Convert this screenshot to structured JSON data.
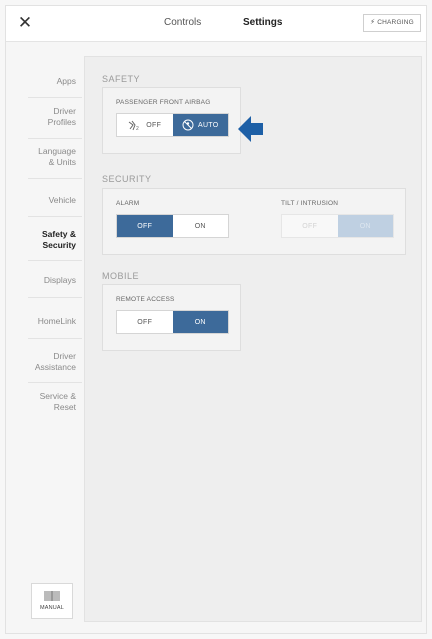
{
  "topbar": {
    "close_icon": "✕",
    "tabs": {
      "controls": "Controls",
      "settings": "Settings"
    },
    "charging_icon": "lightning-bolt-icon",
    "charging_label": "CHARGING"
  },
  "sidebar": {
    "items": [
      {
        "label": "Apps",
        "active": false
      },
      {
        "label": "Driver Profiles",
        "active": false
      },
      {
        "label": "Language & Units",
        "active": false
      },
      {
        "label": "Vehicle",
        "active": false
      },
      {
        "label": "Safety & Security",
        "active": true
      },
      {
        "label": "Displays",
        "active": false
      },
      {
        "label": "HomeLink",
        "active": false
      },
      {
        "label": "Driver Assistance",
        "active": false
      },
      {
        "label": "Service & Reset",
        "active": false
      }
    ],
    "manual_label": "MANUAL"
  },
  "main": {
    "safety": {
      "title": "SAFETY",
      "airbag": {
        "label": "PASSENGER FRONT AIRBAG",
        "options": [
          "OFF",
          "AUTO"
        ],
        "selected": "AUTO"
      }
    },
    "security": {
      "title": "SECURITY",
      "alarm": {
        "label": "ALARM",
        "options": [
          "OFF",
          "ON"
        ],
        "selected": "OFF"
      },
      "tilt": {
        "label": "TILT / INTRUSION",
        "options": [
          "OFF",
          "ON"
        ],
        "selected": "ON",
        "enabled": false
      }
    },
    "mobile": {
      "title": "MOBILE",
      "remote": {
        "label": "REMOTE ACCESS",
        "options": [
          "OFF",
          "ON"
        ],
        "selected": "ON"
      }
    }
  },
  "colors": {
    "accent": "#3d6a9a",
    "arrow": "#1d5fa6",
    "panel": "#eeeeee"
  }
}
